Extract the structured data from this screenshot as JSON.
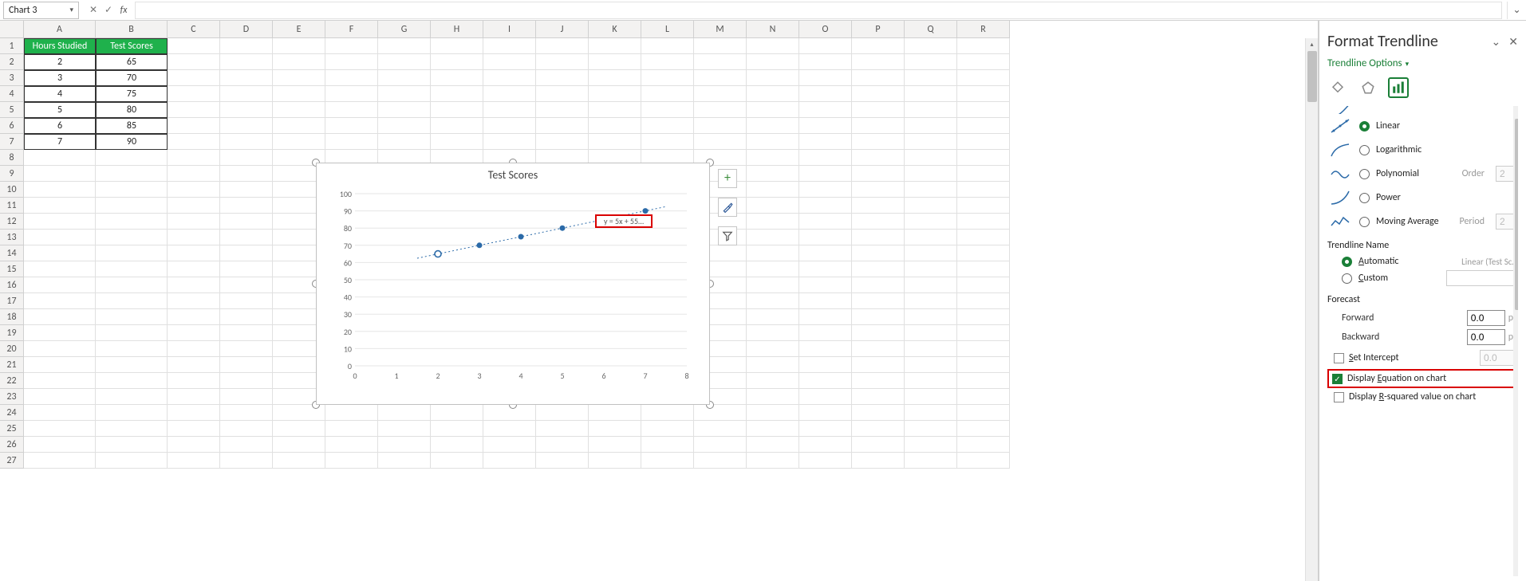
{
  "formula_bar": {
    "name_box": "Chart 3",
    "fx_label": "fx",
    "input_value": ""
  },
  "grid": {
    "columns": [
      "A",
      "B",
      "C",
      "D",
      "E",
      "F",
      "G",
      "H",
      "I",
      "J",
      "K",
      "L",
      "M",
      "N",
      "O",
      "P",
      "Q",
      "R"
    ],
    "row_numbers": [
      1,
      2,
      3,
      4,
      5,
      6,
      7,
      8,
      9,
      10,
      11,
      12,
      13,
      14,
      15,
      16,
      17,
      18,
      19,
      20,
      21,
      22,
      23,
      24,
      25,
      26,
      27
    ],
    "headers": [
      "Hours Studied",
      "Test Scores"
    ],
    "data": [
      [
        2,
        65
      ],
      [
        3,
        70
      ],
      [
        4,
        75
      ],
      [
        5,
        80
      ],
      [
        6,
        85
      ],
      [
        7,
        90
      ]
    ]
  },
  "chart_data": {
    "type": "scatter",
    "title": "Test Scores",
    "x": [
      2,
      3,
      4,
      5,
      6,
      7
    ],
    "y": [
      65,
      70,
      75,
      80,
      85,
      90
    ],
    "xlim": [
      0,
      8
    ],
    "ylim": [
      0,
      100
    ],
    "x_ticks": [
      0,
      1,
      2,
      3,
      4,
      5,
      6,
      7,
      8
    ],
    "y_ticks": [
      0,
      10,
      20,
      30,
      40,
      50,
      60,
      70,
      80,
      90,
      100
    ],
    "trendline": {
      "type": "linear",
      "slope": 5,
      "intercept": 55
    },
    "equation_label": "y = 5x + 55…",
    "selected_point_index": 0
  },
  "chart_flyout": {
    "buttons": [
      "+",
      "brush",
      "filter"
    ]
  },
  "side_panel": {
    "title": "Format Trendline",
    "subtitle": "Trendline Options",
    "tab_icons": [
      "fill",
      "effects",
      "options"
    ],
    "selected_tab": "options",
    "trend_types": [
      {
        "key": "linear",
        "label": "Linear",
        "checked": true
      },
      {
        "key": "log",
        "label": "Logarithmic",
        "checked": false
      },
      {
        "key": "poly",
        "label": "Polynomial",
        "checked": false,
        "extra_label": "Order",
        "extra_val": "2"
      },
      {
        "key": "power",
        "label": "Power",
        "checked": false
      },
      {
        "key": "movavg",
        "label": "Moving Average",
        "checked": false,
        "extra_label": "Period",
        "extra_val": "2"
      }
    ],
    "trendline_name_section": "Trendline Name",
    "name_auto_label": "Automatic",
    "name_auto_value": "Linear (Test Sc…",
    "name_custom_label": "Custom",
    "forecast_section": "Forecast",
    "forecast_forward_label": "Forward",
    "forecast_forward_value": "0.0",
    "forecast_backward_label": "Backward",
    "forecast_backward_value": "0.0",
    "periods_label": "pe",
    "set_intercept_label": "Set Intercept",
    "set_intercept_value": "0.0",
    "display_equation_label": "Display Equation on chart",
    "display_equation_checked": true,
    "display_r2_label": "Display R-squared value on chart",
    "display_r2_checked": false
  }
}
